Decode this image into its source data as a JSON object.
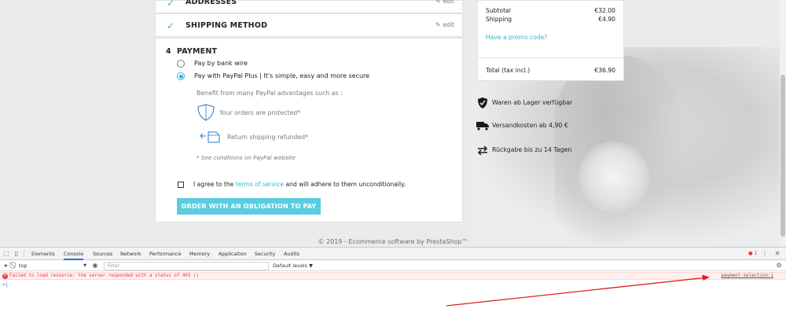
{
  "steps": {
    "addresses": {
      "title": "Addresses",
      "edit": "edit"
    },
    "shipping": {
      "title": "Shipping Method",
      "edit": "edit"
    },
    "payment": {
      "number": "4",
      "title": "Payment",
      "options": [
        {
          "label": "Pay by bank wire",
          "selected": false
        },
        {
          "label": "Pay with PayPal Plus | It's simple, easy and more secure",
          "selected": true
        }
      ],
      "benefits_heading": "Benefit from many PayPal advantages such as :",
      "benefit_protected": "Your orders are protected*",
      "benefit_refund": "Return shipping refunded*",
      "conditions_note": "* See conditions on PayPal website",
      "tos_before": "I agree to the",
      "tos_link": "terms of service",
      "tos_after": "and will adhere to them unconditionally.",
      "order_button": "Order with an obligation to pay"
    }
  },
  "summary": {
    "subtotal_label": "Subtotal",
    "subtotal_value": "€32.00",
    "shipping_label": "Shipping",
    "shipping_value": "€4.90",
    "promo_link": "Have a promo code?",
    "total_label": "Total (tax incl.)",
    "total_value": "€36.90"
  },
  "reassurance": [
    {
      "icon": "shield-check-icon",
      "text": "Waren ab Lager verfügbar"
    },
    {
      "icon": "truck-icon",
      "text": "Versandkosten ab 4,90 €"
    },
    {
      "icon": "swap-arrows-icon",
      "text": "Rückgabe bis zu 14 Tagen"
    }
  ],
  "footer": "© 2019 - Ecommerce software by PrestaShop™",
  "devtools": {
    "tabs": [
      "Elements",
      "Console",
      "Sources",
      "Network",
      "Performance",
      "Memory",
      "Application",
      "Security",
      "Audits"
    ],
    "active_tab": "Console",
    "context": "top",
    "filter_placeholder": "Filter",
    "levels": "Default levels ▼",
    "error_count": "1",
    "error_message": "Failed to load resource: the server responded with a status of 403 ()",
    "error_source": "payment-selection:1",
    "prompt": ">|"
  },
  "colors": {
    "accent": "#25b9d7",
    "check": "#4cbb6c",
    "button": "#5bcde0",
    "error": "#e03b3b",
    "annotation": "#e02020"
  }
}
